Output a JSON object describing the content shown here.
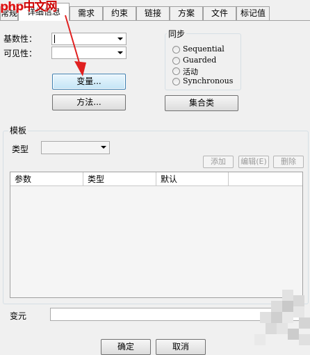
{
  "logo": {
    "part1": "php",
    "part2": "中文网"
  },
  "tabs": [
    {
      "label": "常规"
    },
    {
      "label": "详细信息",
      "active": true
    },
    {
      "label": "需求"
    },
    {
      "label": "约束"
    },
    {
      "label": "链接"
    },
    {
      "label": "方案"
    },
    {
      "label": "文件"
    },
    {
      "label": "标记值"
    }
  ],
  "form": {
    "cardinality_label": "基数性：",
    "visibility_label": "可见性：",
    "attributes_button": "变量...",
    "operations_button": "方法...",
    "collection_button": "集合类"
  },
  "sync": {
    "title": "同步",
    "options": [
      "Sequential",
      "Guarded",
      "活动",
      "Synchronous"
    ]
  },
  "template": {
    "title": "模板",
    "type_label": "类型",
    "add_button": "添加",
    "edit_button": "编辑(E)",
    "delete_button": "删除",
    "columns": [
      "参数",
      "类型",
      "默认"
    ]
  },
  "footer": {
    "variant_label": "变元",
    "ok_button": "确定",
    "cancel_button": "取消"
  },
  "colors": {
    "annotation_arrow": "#e02020",
    "logo_red": "#d11111"
  },
  "icons": [
    "dropdown-arrow",
    "radio-button",
    "red-annotation-arrow"
  ]
}
